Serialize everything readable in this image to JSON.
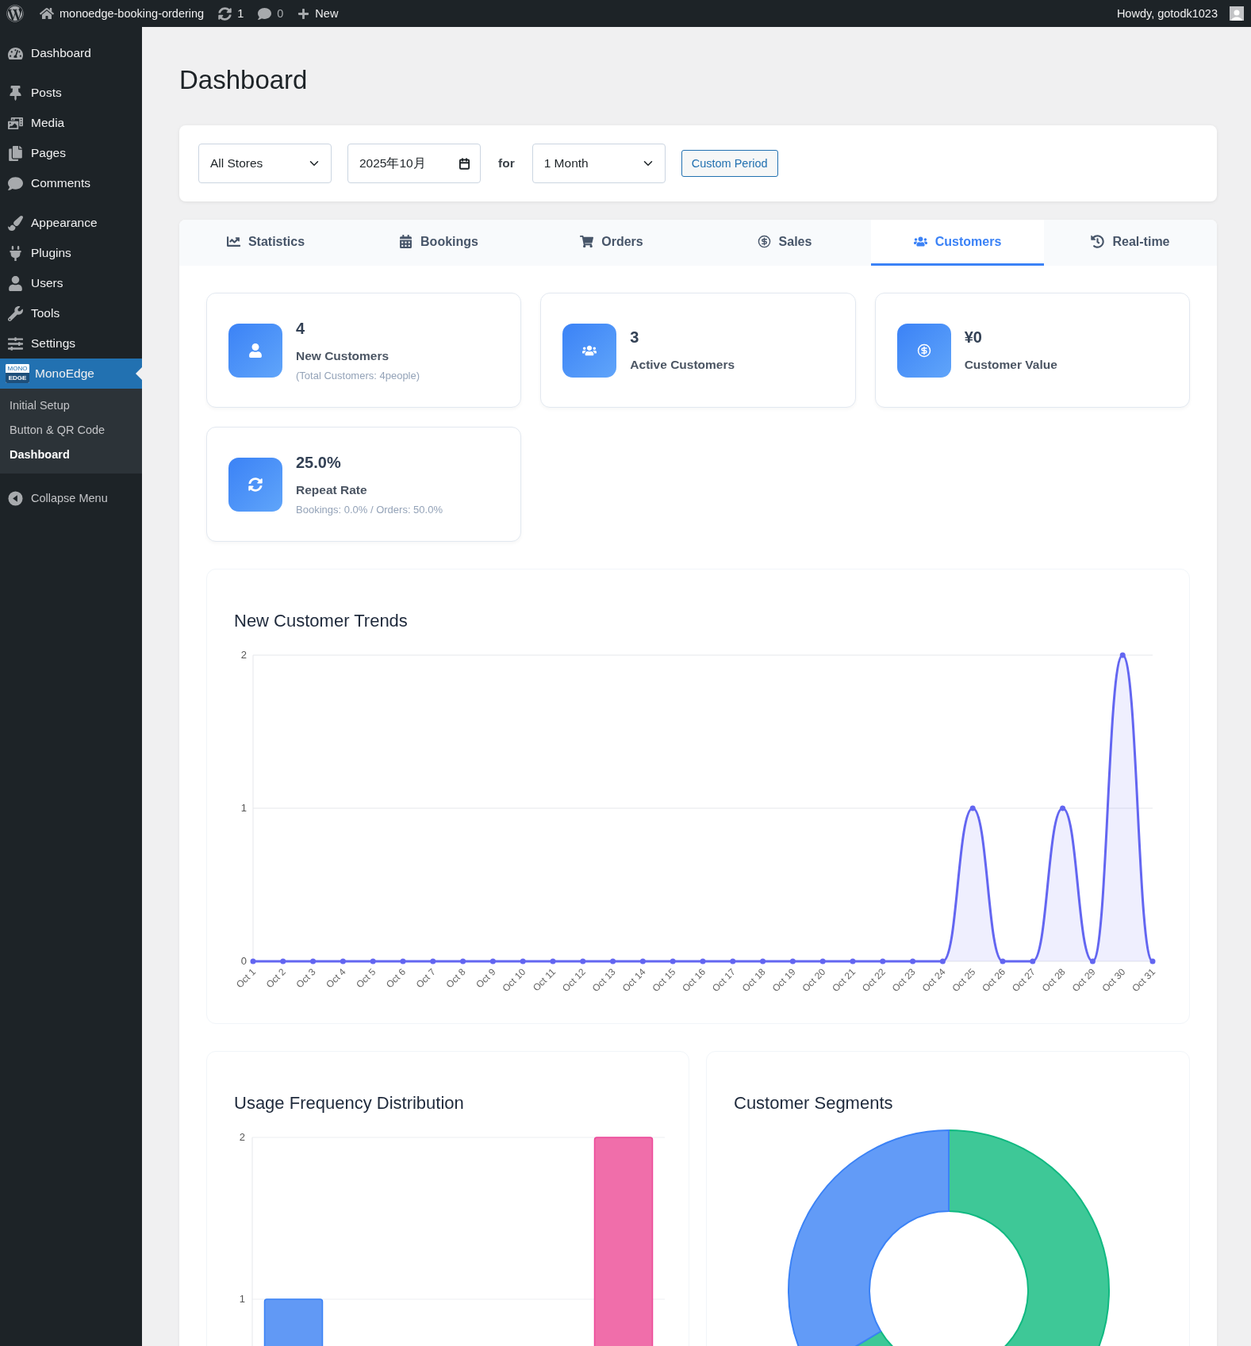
{
  "admin_bar": {
    "site_name": "monoedge-booking-ordering",
    "updates": "1",
    "comments": "0",
    "new_label": "New",
    "greeting": "Howdy, gotodk1023"
  },
  "sidebar": {
    "groups": [
      [
        {
          "label": "Dashboard",
          "selected": false
        }
      ],
      [
        {
          "label": "Posts",
          "selected": false
        },
        {
          "label": "Media",
          "selected": false
        },
        {
          "label": "Pages",
          "selected": false
        },
        {
          "label": "Comments",
          "selected": false
        }
      ],
      [
        {
          "label": "Appearance",
          "selected": false
        },
        {
          "label": "Plugins",
          "selected": false
        },
        {
          "label": "Users",
          "selected": false
        },
        {
          "label": "Tools",
          "selected": false
        },
        {
          "label": "Settings",
          "selected": false
        },
        {
          "label": "MonoEdge",
          "selected": true,
          "logo_text": [
            "MONO",
            "EDGE"
          ],
          "children": [
            {
              "label": "Initial Setup",
              "selected": false
            },
            {
              "label": "Button & QR Code",
              "selected": false
            },
            {
              "label": "Dashboard",
              "selected": true
            }
          ]
        }
      ]
    ],
    "collapse_label": "Collapse Menu"
  },
  "page_title": "Dashboard",
  "filters": {
    "store": "All Stores",
    "month": "2025年10月",
    "for_label": "for",
    "period": "1 Month",
    "custom_button": "Custom Period"
  },
  "tabs": [
    {
      "label": "Statistics",
      "selected": false
    },
    {
      "label": "Bookings",
      "selected": false
    },
    {
      "label": "Orders",
      "selected": false
    },
    {
      "label": "Sales",
      "selected": false
    },
    {
      "label": "Customers",
      "selected": true
    },
    {
      "label": "Real-time",
      "selected": false
    }
  ],
  "stat_cards": [
    {
      "value": "4",
      "label": "New Customers",
      "note": "(Total Customers: 4people)"
    },
    {
      "value": "3",
      "label": "Active Customers"
    },
    {
      "value": "¥0",
      "label": "Customer Value"
    },
    {
      "value": "25.0%",
      "label": "Repeat Rate",
      "note": "Bookings: 0.0% / Orders: 50.0%"
    }
  ],
  "trend_chart": {
    "chart_data": {
      "type": "area",
      "title": "New Customer Trends",
      "categories": [
        "Oct 1",
        "Oct 2",
        "Oct 3",
        "Oct 4",
        "Oct 5",
        "Oct 6",
        "Oct 7",
        "Oct 8",
        "Oct 9",
        "Oct 10",
        "Oct 11",
        "Oct 12",
        "Oct 13",
        "Oct 14",
        "Oct 15",
        "Oct 16",
        "Oct 17",
        "Oct 18",
        "Oct 19",
        "Oct 20",
        "Oct 21",
        "Oct 22",
        "Oct 23",
        "Oct 24",
        "Oct 25",
        "Oct 26",
        "Oct 27",
        "Oct 28",
        "Oct 29",
        "Oct 30",
        "Oct 31"
      ],
      "series": [
        {
          "color": "#6366f1",
          "values": [
            0,
            0,
            0,
            0,
            0,
            0,
            0,
            0,
            0,
            0,
            0,
            0,
            0,
            0,
            0,
            0,
            0,
            0,
            0,
            0,
            0,
            0,
            0,
            0,
            1,
            0,
            0,
            1,
            0,
            2,
            0
          ]
        }
      ],
      "ylim": [
        0,
        2
      ],
      "yticks": [
        0,
        1,
        2
      ]
    }
  },
  "frequency_chart": {
    "chart_data": {
      "type": "bar",
      "title": "Usage Frequency Distribution",
      "values": [
        1,
        0,
        0,
        0,
        2
      ],
      "ylim": [
        0,
        2
      ],
      "yticks": [
        1,
        2
      ]
    }
  },
  "segments_chart": {
    "title": "Customer Segments"
  }
}
